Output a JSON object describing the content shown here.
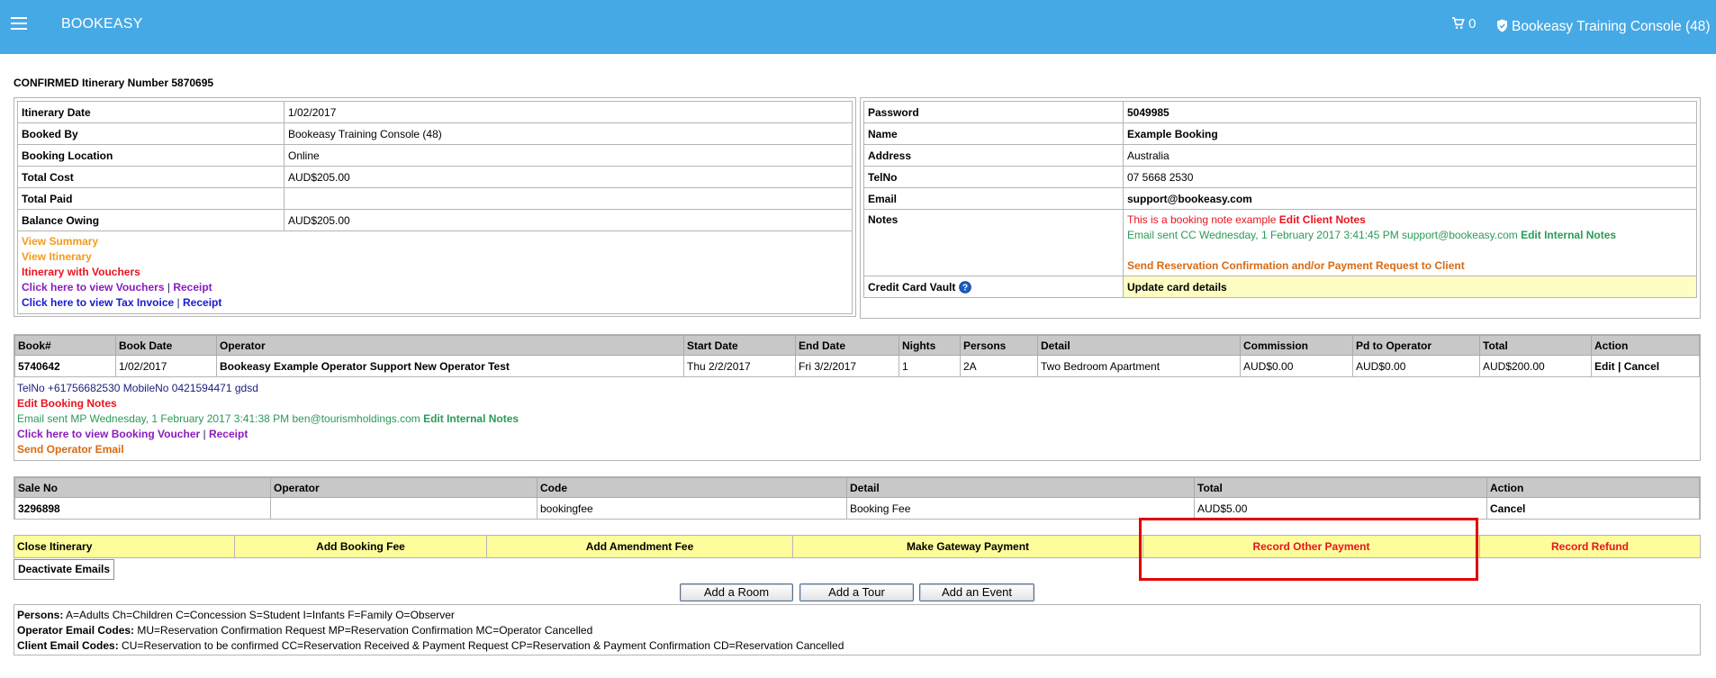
{
  "header": {
    "brand": "BOOKEASY",
    "cart_count": "0",
    "account_label": "Bookeasy Training Console (48)",
    "bg_color": "#45a9e6"
  },
  "page_title": "CONFIRMED Itinerary Number 5870695",
  "itinerary": {
    "rows": [
      {
        "label": "Itinerary Date",
        "value": "1/02/2017"
      },
      {
        "label": "Booked By",
        "value": "Bookeasy Training Console (48)"
      },
      {
        "label": "Booking Location",
        "value": "Online"
      },
      {
        "label": "Total Cost",
        "value": "AUD$205.00"
      },
      {
        "label": "Total Paid",
        "value": ""
      },
      {
        "label": "Balance Owing",
        "value": "AUD$205.00"
      }
    ],
    "links": {
      "view_summary": "View Summary",
      "view_itinerary": "View Itinerary",
      "itinerary_vouchers": "Itinerary with Vouchers",
      "view_vouchers": "Click here to view Vouchers",
      "vouchers_receipt": "Receipt",
      "view_tax_invoice": "Click here to view Tax Invoice",
      "tax_receipt": "Receipt",
      "separator": "|"
    }
  },
  "client": {
    "rows": [
      {
        "label": "Password",
        "value": "5049985"
      },
      {
        "label": "Name",
        "value": "Example Booking"
      },
      {
        "label": "Address",
        "value": "Australia"
      },
      {
        "label": "TelNo",
        "value": "07 5668 2530"
      },
      {
        "label": "Email",
        "value": "support@bookeasy.com"
      }
    ],
    "notes_label": "Notes",
    "note_text": "This is a booking note example",
    "edit_client_notes": "Edit Client Notes",
    "email_sent": "Email sent CC Wednesday, 1 February 2017 3:41:45 PM support@bookeasy.com",
    "edit_internal_notes": "Edit Internal Notes",
    "send_confirmation": "Send Reservation Confirmation and/or Payment Request to Client",
    "card_vault_label": "Credit Card Vault",
    "update_card": "Update card details"
  },
  "bookings": {
    "headers": [
      "Book#",
      "Book Date",
      "Operator",
      "Start Date",
      "End Date",
      "Nights",
      "Persons",
      "Detail",
      "Commission",
      "Pd to Operator",
      "Total",
      "Action"
    ],
    "row": {
      "book_no": "5740642",
      "book_date": "1/02/2017",
      "operator": "Bookeasy Example Operator Support New Operator Test",
      "start_date": "Thu 2/2/2017",
      "end_date": "Fri 3/2/2017",
      "nights": "1",
      "persons": "2A",
      "detail": "Two Bedroom Apartment",
      "commission": "AUD$0.00",
      "pd_to_operator": "AUD$0.00",
      "total": "AUD$200.00",
      "action_edit": "Edit",
      "action_sep": "|",
      "action_cancel": "Cancel"
    },
    "tel_line": "TelNo +61756682530 MobileNo 0421594471 gdsd",
    "edit_booking_notes": "Edit Booking Notes",
    "email_sent": "Email sent MP Wednesday, 1 February 2017 3:41:38 PM ben@tourismholdings.com",
    "edit_internal_notes": "Edit Internal Notes",
    "view_voucher": "Click here to view Booking Voucher",
    "voucher_receipt": "Receipt",
    "send_operator_email": "Send Operator Email"
  },
  "sales": {
    "headers": [
      "Sale No",
      "Operator",
      "Code",
      "Detail",
      "Total",
      "Action"
    ],
    "row": {
      "sale_no": "3296898",
      "operator": "",
      "code": "bookingfee",
      "detail": "Booking Fee",
      "total": "AUD$5.00",
      "action": "Cancel"
    }
  },
  "actions": {
    "close_itinerary": "Close Itinerary",
    "add_booking_fee": "Add Booking Fee",
    "add_amendment_fee": "Add Amendment Fee",
    "make_gateway_payment": "Make Gateway Payment",
    "record_other_payment": "Record Other Payment",
    "record_refund": "Record Refund",
    "deactivate_emails": "Deactivate Emails"
  },
  "add_buttons": {
    "room": "Add a Room",
    "tour": "Add a Tour",
    "event": "Add an Event"
  },
  "legend": {
    "persons_label": "Persons:",
    "persons_text": "A=Adults Ch=Children C=Concession S=Student I=Infants F=Family O=Observer",
    "operator_label": "Operator Email Codes:",
    "operator_text": "MU=Reservation Confirmation Request MP=Reservation Confirmation MC=Operator Cancelled",
    "client_label": "Client Email Codes:",
    "client_text": "CU=Reservation to be confirmed CC=Reservation Received & Payment Request CP=Reservation & Payment Confirmation CD=Reservation Cancelled"
  }
}
